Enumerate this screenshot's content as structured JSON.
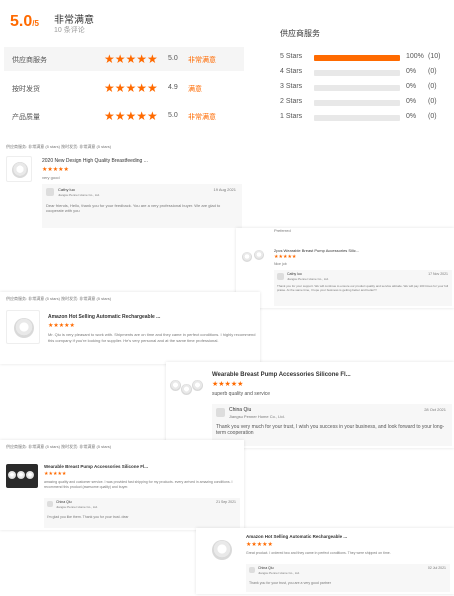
{
  "summary": {
    "score": "5.0",
    "score_suffix": "/5",
    "rating_label": "非常满意",
    "review_count": "10 条评论",
    "metrics": [
      {
        "name": "供应商服务",
        "score": "5.0",
        "label": "非常满意"
      },
      {
        "name": "按时发货",
        "score": "4.9",
        "label": "满意"
      },
      {
        "name": "产品质量",
        "score": "5.0",
        "label": "非常满意"
      }
    ]
  },
  "breakdown": {
    "title": "供应商服务",
    "rows": [
      {
        "label": "5 Stars",
        "percent": "100%",
        "count": "(10)",
        "fill": 1.0
      },
      {
        "label": "4 Stars",
        "percent": "0%",
        "count": "(0)",
        "fill": 0
      },
      {
        "label": "3 Stars",
        "percent": "0%",
        "count": "(0)",
        "fill": 0
      },
      {
        "label": "2 Stars",
        "percent": "0%",
        "count": "(0)",
        "fill": 0
      },
      {
        "label": "1 Stars",
        "percent": "0%",
        "count": "(0)",
        "fill": 0
      }
    ]
  },
  "colors": {
    "accent": "#ff6a00",
    "track": "#e8e8e8"
  },
  "reviews": {
    "r1": {
      "meta": "供应商服务:  非常满意 (5 stars)     按时发货:  非常满意 (5 stars)",
      "title": "2020 New Design High Quality Breastfeeding ...",
      "body": "very good",
      "reply_name": "Cathy luo",
      "reply_company": "Jiangsu Penner Home Co., Ltd.",
      "reply_date": "19 Aug 2021",
      "reply_text": "Dear friends, Hello, thank you for your feedback. You are a very professional buyer. We are glad to cooperate with you"
    },
    "r2": {
      "meta": "Preferred",
      "title": "2pcs Wearable Breast Pump Accessories Silic...",
      "body": "Nice job",
      "reply_name": "Cathy luo",
      "reply_company": "Jiangsu Penner Home Co., Ltd.",
      "reply_date": "17 Nov 2021",
      "reply_text": "Thank you for your support. We will continue to ensure our product quality and service attitude. We will pay 100 times for your full praise. At the same time, I hope your business is getting better and better!!!"
    },
    "r3": {
      "meta": "供应商服务:  非常满意 (5 stars)     按时发货:  非常满意 (5 stars)",
      "title": "Amazon Hot Selling Automatic Rechargeable ...",
      "body": "Mr. Qiu is very pleasant to work with. Shipments are on time and they came in perfect conditions. I highly recommend this company if you're looking for supplier. He's very personal and at the same time professional."
    },
    "r4": {
      "title": "Wearable Breast Pump Accessories Silicone Fl...",
      "body": "superb quality and service",
      "reply_name": "China Qiu",
      "reply_company": "Jiangsu Penner Home Co., Ltd.",
      "reply_date": "28 Oct 2021",
      "reply_text": "Thank you very much for your trust, I wish you success in your business, and look forward to your long-term cooperation"
    },
    "r5": {
      "meta": "供应商服务:  非常满意 (5 stars)     按时发货:  非常满意 (5 stars)",
      "title": "Wearable Breast Pump Accessories Silicone Fl...",
      "body": "amazing quality and customer service. I was provided fast shipping for my products. every arrived in amazing conditions. I recommend this product (awesome quality) and buyer.",
      "reply_name": "China Qiu",
      "reply_company": "Jiangsu Penner Home Co., Ltd.",
      "reply_date": "21 Sep 2021",
      "reply_text": "I'm glad you like them. Thank you for your trust. dear"
    },
    "r6": {
      "title": "Amazon Hot Selling Automatic Rechargeable ...",
      "body": "Great product. I ordered two and they came in perfect conditions. They were shipped on time.",
      "reply_name": "China Qiu",
      "reply_company": "Jiangsu Penner Home Co., Ltd.",
      "reply_date": "02 Jul 2021",
      "reply_text": "Thank you for your trust, you are a very good partner"
    }
  },
  "stars": "★★★★★"
}
